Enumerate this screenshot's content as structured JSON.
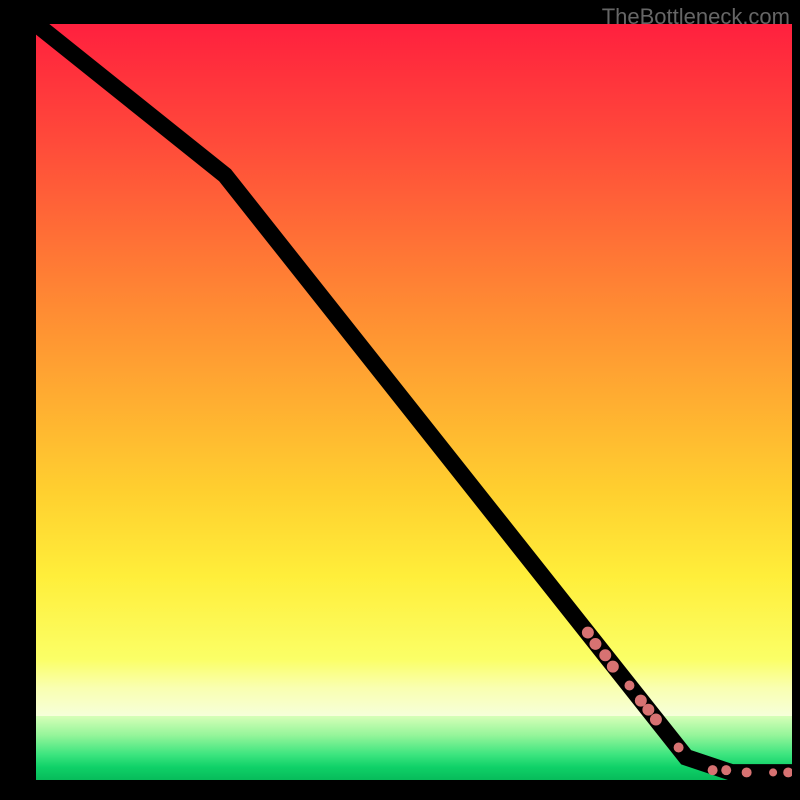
{
  "watermark": "TheBottleneck.com",
  "colors": {
    "top": "#ff203e",
    "bottom": "#07bb5a",
    "dot": "#d77272",
    "line": "#000000"
  },
  "chart_data": {
    "type": "line",
    "title": "",
    "xlabel": "",
    "ylabel": "",
    "xlim": [
      0,
      100
    ],
    "ylim": [
      0,
      100
    ],
    "grid": false,
    "legend": false,
    "line": {
      "name": "curve",
      "points": [
        {
          "x": 0,
          "y": 100
        },
        {
          "x": 25,
          "y": 80
        },
        {
          "x": 86,
          "y": 3
        },
        {
          "x": 92,
          "y": 1
        },
        {
          "x": 100,
          "y": 1
        }
      ]
    },
    "scatter": {
      "name": "markers",
      "points": [
        {
          "x": 73,
          "y": 19.5,
          "r": 6
        },
        {
          "x": 74,
          "y": 18.0,
          "r": 6
        },
        {
          "x": 75.3,
          "y": 16.5,
          "r": 6
        },
        {
          "x": 76.3,
          "y": 15.0,
          "r": 6
        },
        {
          "x": 78.5,
          "y": 12.5,
          "r": 5
        },
        {
          "x": 80.0,
          "y": 10.5,
          "r": 6
        },
        {
          "x": 81.0,
          "y": 9.3,
          "r": 6
        },
        {
          "x": 82.0,
          "y": 8.0,
          "r": 6
        },
        {
          "x": 85.0,
          "y": 4.3,
          "r": 5
        },
        {
          "x": 89.5,
          "y": 1.3,
          "r": 5
        },
        {
          "x": 91.3,
          "y": 1.3,
          "r": 5
        },
        {
          "x": 94.0,
          "y": 1.0,
          "r": 5
        },
        {
          "x": 97.5,
          "y": 1.0,
          "r": 4
        },
        {
          "x": 99.5,
          "y": 1.0,
          "r": 5
        }
      ]
    }
  }
}
